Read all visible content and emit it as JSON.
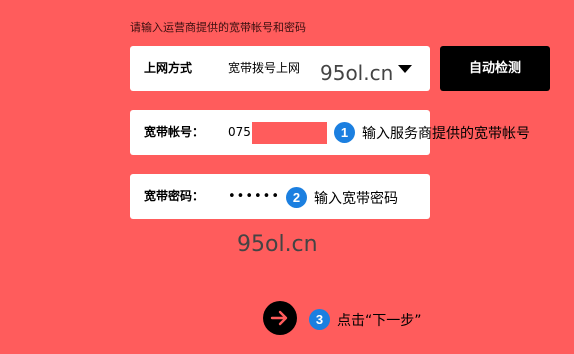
{
  "hint": "请输入运营商提供的宽带帐号和密码",
  "connection": {
    "label": "上网方式",
    "selected": "宽带拨号上网",
    "watermark": "95ol.cn"
  },
  "auto_detect_label": "自动检测",
  "account": {
    "label": "宽带帐号：",
    "value": "075"
  },
  "password": {
    "label": "宽带密码：",
    "value": "••••••"
  },
  "steps": [
    {
      "num": "1",
      "text": "输入服务商提供的宽带帐号"
    },
    {
      "num": "2",
      "text": "输入宽带密码"
    },
    {
      "num": "3",
      "text": "点击“下一步”"
    }
  ],
  "watermark": "95ol.cn",
  "icons": {
    "next": "arrow-right-icon",
    "dropdown": "caret-down-icon"
  },
  "colors": {
    "background": "#ff5c5c",
    "step_badge": "#1b7fe0",
    "button": "#000000"
  }
}
